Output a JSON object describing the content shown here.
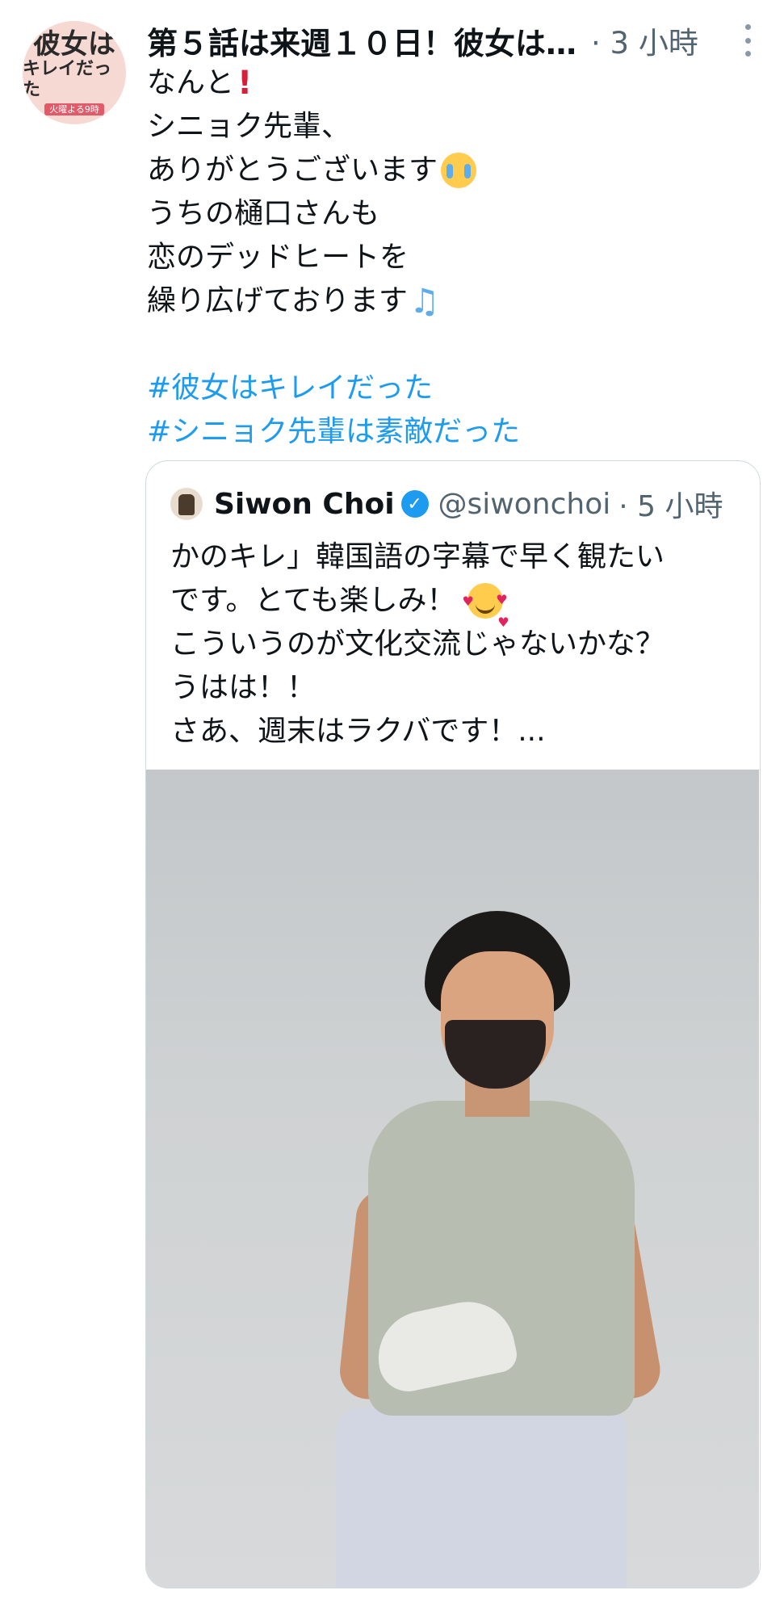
{
  "tweet": {
    "avatar": {
      "logo_lines": [
        "彼女は",
        "キレイだった"
      ],
      "logo_badge": "火曜よる9時"
    },
    "title": "第５話は来週１０日！彼女は…",
    "time": "· 3 小時",
    "lines": [
      "なんと",
      "シニョク先輩、",
      "ありがとうございます",
      "うちの樋口さんも",
      "恋のデッドヒートを",
      "繰り広げております"
    ],
    "hashtags": [
      "#彼女はキレイだった",
      "#シニョク先輩は素敵だった"
    ]
  },
  "quote": {
    "name": "Siwon Choi",
    "handle": "@siwonchoi",
    "time": "· 5 小時",
    "lines": [
      "かのキレ」韓国語の字幕で早く観たい",
      "です。とても楽しみ！",
      "こういうのが文化交流じゃないかな？",
      "うはは！！",
      "さあ、週末はラクバです！..."
    ]
  }
}
